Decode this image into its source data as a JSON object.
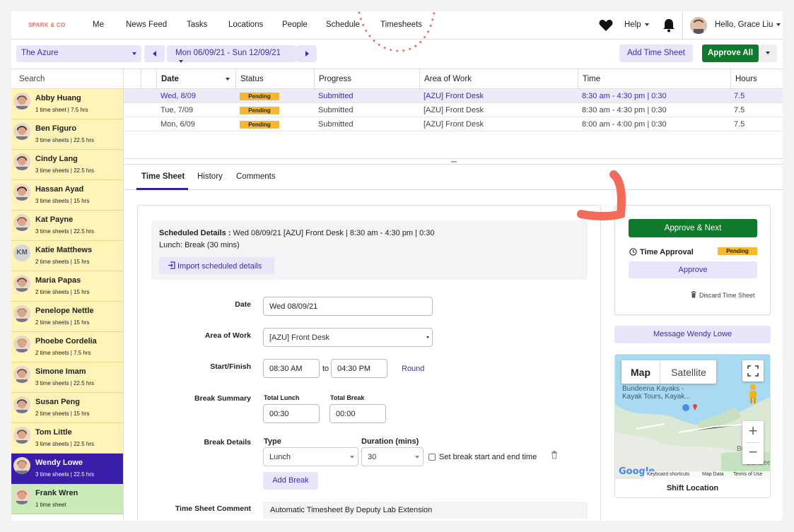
{
  "brand": {
    "logo_text": "SPARK & CO",
    "accent": "#3a1ea8",
    "green": "#0f7a2b",
    "pending": "#f5b82e",
    "highlight": "#f26b5b"
  },
  "nav": {
    "items": [
      "Me",
      "News Feed",
      "Tasks",
      "Locations",
      "People",
      "Schedule",
      "Timesheets"
    ],
    "help_label": "Help",
    "user_greeting": "Hello, Grace Liu"
  },
  "toolbar": {
    "location": "The Azure",
    "date_range": "Mon 06/09/21 - Sun 12/09/21",
    "add_time_sheet": "Add Time Sheet",
    "approve_all": "Approve All"
  },
  "sidebar": {
    "search_placeholder": "Search",
    "people": [
      {
        "name": "Abby Huang",
        "meta": "1 time sheet | 7.5 hrs",
        "state": "pending"
      },
      {
        "name": "Ben Figuro",
        "meta": "3 time sheets | 22.5 hrs",
        "state": "pending"
      },
      {
        "name": "Cindy Lang",
        "meta": "3 time sheets | 22.5 hrs",
        "state": "pending"
      },
      {
        "name": "Hassan Ayad",
        "meta": "3 time sheets | 15 hrs",
        "state": "pending"
      },
      {
        "name": "Kat Payne",
        "meta": "3 time sheets | 22.5 hrs",
        "state": "pending"
      },
      {
        "name": "Katie Matthews",
        "meta": "2 time sheets | 15 hrs",
        "state": "pending",
        "initials": "KM"
      },
      {
        "name": "Maria Papas",
        "meta": "2 time sheets | 15 hrs",
        "state": "pending"
      },
      {
        "name": "Penelope Nettle",
        "meta": "2 time sheets | 15 hrs",
        "state": "pending"
      },
      {
        "name": "Phoebe Cordelia",
        "meta": "2 time sheets | 7.5 hrs",
        "state": "pending"
      },
      {
        "name": "Simone Imam",
        "meta": "3 time sheets | 22.5 hrs",
        "state": "pending"
      },
      {
        "name": "Susan Peng",
        "meta": "2 time sheets | 15 hrs",
        "state": "pending"
      },
      {
        "name": "Tom Little",
        "meta": "3 time sheets | 22.5 hrs",
        "state": "pending"
      },
      {
        "name": "Wendy Lowe",
        "meta": "3 time sheets | 22.5 hrs",
        "state": "active"
      },
      {
        "name": "Frank Wren",
        "meta": "1 time sheet",
        "state": "approved"
      }
    ]
  },
  "table": {
    "headers": [
      "Date",
      "Status",
      "Progress",
      "Area of Work",
      "Time",
      "Hours"
    ],
    "rows": [
      {
        "date": "Wed, 8/09",
        "status": "Pending",
        "progress": "Submitted",
        "area": "[AZU] Front Desk",
        "time": "8:30 am - 4:30 pm | 0:30",
        "hours": "7.5"
      },
      {
        "date": "Tue, 7/09",
        "status": "Pending",
        "progress": "Submitted",
        "area": "[AZU] Front Desk",
        "time": "8:30 am - 4:30 pm | 0:30",
        "hours": "7.5"
      },
      {
        "date": "Mon, 6/09",
        "status": "Pending",
        "progress": "Submitted",
        "area": "[AZU] Front Desk",
        "time": "8:00 am - 4:00 pm | 0:30",
        "hours": "7.5"
      }
    ]
  },
  "tabs": [
    "Time Sheet",
    "History",
    "Comments"
  ],
  "form": {
    "scheduled_label": "Scheduled Details :",
    "scheduled_text": "Wed 08/09/21 [AZU] Front Desk | 8:30 am - 4:30 pm | 0:30",
    "lunch_text": "Lunch: Break (30 mins)",
    "import_label": "Import scheduled details",
    "date_label": "Date",
    "date_value": "Wed 08/09/21",
    "area_label": "Area of Work",
    "area_value": "[AZU] Front Desk",
    "startfinish_label": "Start/Finish",
    "start_value": "08:30 AM",
    "to_text": "to",
    "finish_value": "04:30 PM",
    "round_label": "Round",
    "break_summary_label": "Break Summary",
    "total_lunch_label": "Total Lunch",
    "total_lunch_value": "00:30",
    "total_break_label": "Total Break",
    "total_break_value": "00:00",
    "break_details_label": "Break Details",
    "type_label": "Type",
    "type_value": "Lunch",
    "duration_label": "Duration (mins)",
    "duration_value": "30",
    "set_break_label": "Set break start and end time",
    "add_break_label": "Add Break",
    "comment_label": "Time Sheet Comment",
    "comment_value": "Automatic Timesheet By Deputy Lab Extension"
  },
  "approval": {
    "approve_next": "Approve & Next",
    "time_approval_label": "Time Approval",
    "status": "Pending",
    "approve": "Approve",
    "discard": "Discard Time Sheet",
    "message": "Message Wendy Lowe"
  },
  "map": {
    "tab_map": "Map",
    "tab_satellite": "Satellite",
    "place_label_1": "Bundeena Kayaks -",
    "place_label_2": "Kayak Tours, Kayak...",
    "place_label_3": "Bundee",
    "place_label_4": "Bundeena",
    "keyboard": "Keyboard shortcuts",
    "map_data": "Map Data",
    "terms": "Terms of Use",
    "google": "Google",
    "caption": "Shift Location"
  }
}
